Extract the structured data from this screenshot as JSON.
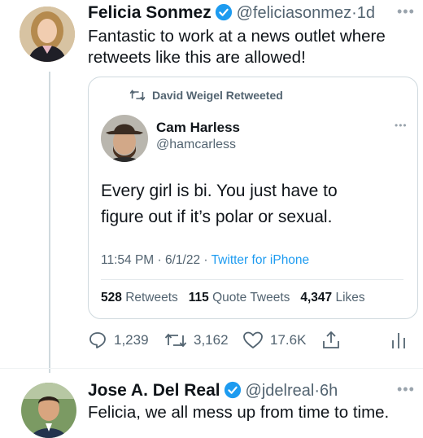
{
  "tweet": {
    "author_name": "Felicia Sonmez",
    "handle": "@feliciasonmez",
    "separator": "·",
    "time": "1d",
    "more": "•••",
    "text_line1": "Fantastic to work at a news outlet where",
    "text_line2": "retweets like this are allowed!",
    "actions": {
      "replies": "1,239",
      "retweets": "3,162",
      "likes": "17.6K"
    }
  },
  "quoted": {
    "retweeted_by": "David Weigel Retweeted",
    "author_name": "Cam Harless",
    "handle": "@hamcarless",
    "more": "•••",
    "text_line1": "Every girl is bi. You just have to",
    "text_line2": "figure out if it’s polar or sexual.",
    "time": "11:54 PM · 6/1/22 ·",
    "source": "Twitter for iPhone",
    "stats": {
      "retweets_count": "528",
      "retweets_label": "Retweets",
      "quotes_count": "115",
      "quotes_label": "Quote Tweets",
      "likes_count": "4,347",
      "likes_label": "Likes"
    }
  },
  "reply": {
    "author_name": "Jose A. Del Real",
    "handle": "@jdelreal",
    "separator": "·",
    "time": "6h",
    "more": "•••",
    "text_line1": "Felicia, we all mess up from time to time."
  },
  "colors": {
    "verified": "#1d9bf0",
    "link": "#1d9bf0",
    "muted": "#536471",
    "border": "#cfd9de"
  }
}
